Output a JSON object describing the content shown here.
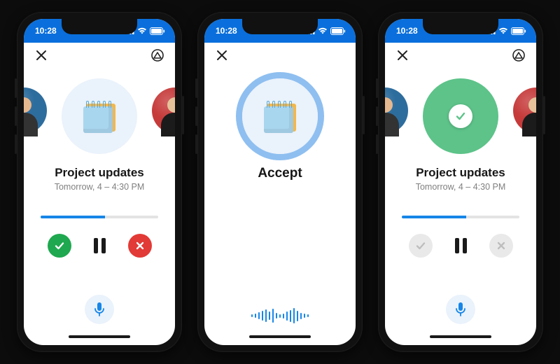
{
  "status": {
    "time": "10:28"
  },
  "colors": {
    "brand": "#0a6fdc",
    "accent": "#1686e8",
    "accept": "#1fa84f",
    "decline": "#e23a36",
    "success": "#5dc389"
  },
  "screens": [
    {
      "id": "playback",
      "title": "Project updates",
      "subtitle": "Tomorrow, 4 – 4:30 PM",
      "progress_percent": 55,
      "actions_active": true,
      "show_avatars": true,
      "hero": "notepad",
      "footer": "mic"
    },
    {
      "id": "voice-accept",
      "title": "Accept",
      "subtitle": "",
      "progress_percent": null,
      "actions_active": false,
      "show_avatars": false,
      "hero": "notepad-ring",
      "footer": "waveform"
    },
    {
      "id": "confirmed",
      "title": "Project updates",
      "subtitle": "Tomorrow, 4 – 4:30 PM",
      "progress_percent": 55,
      "actions_active": false,
      "show_avatars": true,
      "hero": "success",
      "footer": "mic"
    }
  ],
  "icons": {
    "close": "close-icon",
    "cast": "cast-icon",
    "accept": "check-icon",
    "decline": "x-icon",
    "pause": "pause-icon",
    "mic": "mic-icon"
  },
  "waveform_bars": [
    4,
    6,
    10,
    14,
    18,
    12,
    20,
    8,
    5,
    7,
    13,
    17,
    22,
    15,
    9,
    6,
    4
  ]
}
